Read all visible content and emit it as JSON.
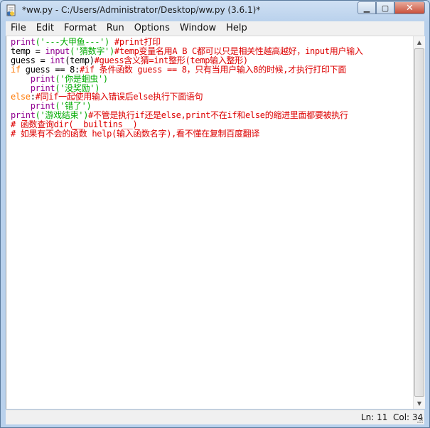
{
  "window": {
    "title": "*ww.py - C:/Users/Administrator/Desktop/ww.py (3.6.1)*",
    "controls": {
      "minimize": "▁",
      "maximize": "▢",
      "close": "✕"
    }
  },
  "menu": [
    "File",
    "Edit",
    "Format",
    "Run",
    "Options",
    "Window",
    "Help"
  ],
  "code": {
    "lines": [
      [
        {
          "t": "print",
          "c": "bi"
        },
        {
          "t": "('---大甲鱼---')",
          "c": "st"
        },
        {
          "t": " #print打印",
          "c": "cm"
        }
      ],
      [
        {
          "t": "temp = ",
          "c": "pl"
        },
        {
          "t": "input",
          "c": "bi"
        },
        {
          "t": "('猜数字')",
          "c": "st"
        },
        {
          "t": "#temp变量名用A B C都可以只是相关性越高越好，input用户输入",
          "c": "cm"
        }
      ],
      [
        {
          "t": "guess = ",
          "c": "pl"
        },
        {
          "t": "int",
          "c": "bi"
        },
        {
          "t": "(temp)",
          "c": "pl"
        },
        {
          "t": "#guess含义猜=int整形(temp输入整形)",
          "c": "cm"
        }
      ],
      [
        {
          "t": "if",
          "c": "kw"
        },
        {
          "t": " guess == 8:",
          "c": "pl"
        },
        {
          "t": "#if 条件函数 guess == 8，只有当用户输入8的时候,才执行打印下面",
          "c": "cm"
        }
      ],
      [
        {
          "t": "    ",
          "c": "pl"
        },
        {
          "t": "print",
          "c": "bi"
        },
        {
          "t": "('你是蛔虫')",
          "c": "st"
        }
      ],
      [
        {
          "t": "    ",
          "c": "pl"
        },
        {
          "t": "print",
          "c": "bi"
        },
        {
          "t": "('没奖励')",
          "c": "st"
        }
      ],
      [
        {
          "t": "else",
          "c": "kw"
        },
        {
          "t": ":",
          "c": "pl"
        },
        {
          "t": "#同if一起使用输入错误后else执行下面语句",
          "c": "cm"
        }
      ],
      [
        {
          "t": "    ",
          "c": "pl"
        },
        {
          "t": "print",
          "c": "bi"
        },
        {
          "t": "('错了')",
          "c": "st"
        }
      ],
      [
        {
          "t": "print",
          "c": "bi"
        },
        {
          "t": "('游戏结束')",
          "c": "st"
        },
        {
          "t": "#不管是执行if还是else,print不在if和else的缩进里面都要被执行",
          "c": "cm"
        }
      ],
      [
        {
          "t": "# 函数查询dir(__builtins__)",
          "c": "cm"
        }
      ],
      [
        {
          "t": "# 如果有不会的函数 help(输入函数名字),看不懂在复制百度翻译",
          "c": "cm"
        }
      ]
    ]
  },
  "status": {
    "line": "Ln: 11",
    "col": "Col: 34"
  }
}
